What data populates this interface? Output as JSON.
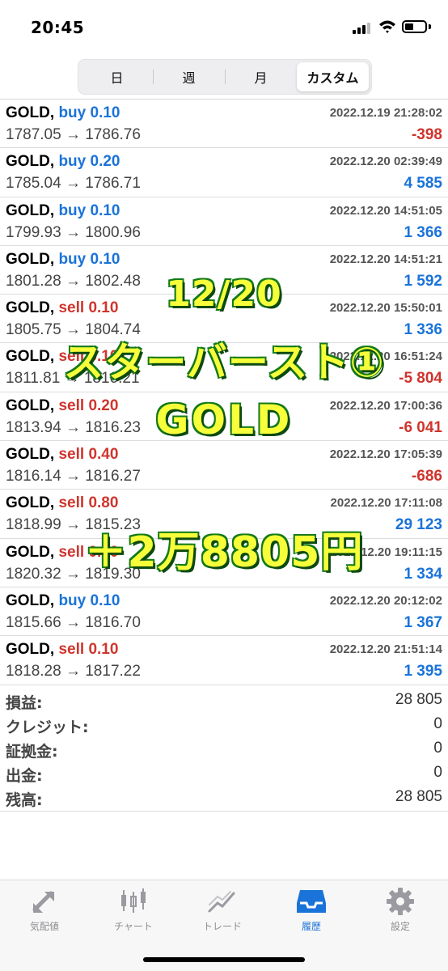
{
  "status_bar": {
    "time": "20:45"
  },
  "segments": [
    "日",
    "週",
    "月",
    "カスタム"
  ],
  "trades": [
    {
      "symbol": "GOLD,",
      "side": "buy",
      "volume": "0.10",
      "prices": "1787.05 → 1786.76",
      "time": "2022.12.19 21:28:02",
      "profit": "-398",
      "sign": "neg"
    },
    {
      "symbol": "GOLD,",
      "side": "buy",
      "volume": "0.20",
      "prices": "1785.04 → 1786.71",
      "time": "2022.12.20 02:39:49",
      "profit": "4 585",
      "sign": "pos"
    },
    {
      "symbol": "GOLD,",
      "side": "buy",
      "volume": "0.10",
      "prices": "1799.93 → 1800.96",
      "time": "2022.12.20 14:51:05",
      "profit": "1 366",
      "sign": "pos"
    },
    {
      "symbol": "GOLD,",
      "side": "buy",
      "volume": "0.10",
      "prices": "1801.28 → 1802.48",
      "time": "2022.12.20 14:51:21",
      "profit": "1 592",
      "sign": "pos"
    },
    {
      "symbol": "GOLD,",
      "side": "sell",
      "volume": "0.10",
      "prices": "1805.75 → 1804.74",
      "time": "2022.12.20 15:50:01",
      "profit": "1 336",
      "sign": "pos"
    },
    {
      "symbol": "GOLD,",
      "side": "sell",
      "volume": "0.10",
      "prices": "1811.81 → 1816.21",
      "time": "2022.12.20 16:51:24",
      "profit": "-5 804",
      "sign": "neg"
    },
    {
      "symbol": "GOLD,",
      "side": "sell",
      "volume": "0.20",
      "prices": "1813.94 → 1816.23",
      "time": "2022.12.20 17:00:36",
      "profit": "-6 041",
      "sign": "neg"
    },
    {
      "symbol": "GOLD,",
      "side": "sell",
      "volume": "0.40",
      "prices": "1816.14 → 1816.27",
      "time": "2022.12.20 17:05:39",
      "profit": "-686",
      "sign": "neg"
    },
    {
      "symbol": "GOLD,",
      "side": "sell",
      "volume": "0.80",
      "prices": "1818.99 → 1815.23",
      "time": "2022.12.20 17:11:08",
      "profit": "29 123",
      "sign": "pos"
    },
    {
      "symbol": "GOLD,",
      "side": "sell",
      "volume": "0.10",
      "prices": "1820.32 → 1819.30",
      "time": "2022.12.20 19:11:15",
      "profit": "1 334",
      "sign": "pos"
    },
    {
      "symbol": "GOLD,",
      "side": "buy",
      "volume": "0.10",
      "prices": "1815.66 → 1816.70",
      "time": "2022.12.20 20:12:02",
      "profit": "1 367",
      "sign": "pos"
    },
    {
      "symbol": "GOLD,",
      "side": "sell",
      "volume": "0.10",
      "prices": "1818.28 → 1817.22",
      "time": "2022.12.20 21:51:14",
      "profit": "1 395",
      "sign": "pos"
    }
  ],
  "summary": [
    {
      "label": "損益:",
      "value": "28 805"
    },
    {
      "label": "クレジット:",
      "value": "0"
    },
    {
      "label": "証拠金:",
      "value": "0"
    },
    {
      "label": "出金:",
      "value": "0"
    },
    {
      "label": "残高:",
      "value": "28 805"
    }
  ],
  "overlay": {
    "date": "12/20",
    "title": "スターバースト①",
    "symbol": "GOLD",
    "amount": "＋2万8805円"
  },
  "tabs": [
    {
      "label": "気配値",
      "icon": "quotes-icon",
      "active": false
    },
    {
      "label": "チャート",
      "icon": "chart-icon",
      "active": false
    },
    {
      "label": "トレード",
      "icon": "trade-icon",
      "active": false
    },
    {
      "label": "履歴",
      "icon": "history-icon",
      "active": true
    },
    {
      "label": "設定",
      "icon": "settings-icon",
      "active": false
    }
  ],
  "colors": {
    "buy": "#1a73d9",
    "sell": "#d0342c",
    "overlay_fill": "#f6ff3a",
    "overlay_stroke": "#0e6a14"
  }
}
